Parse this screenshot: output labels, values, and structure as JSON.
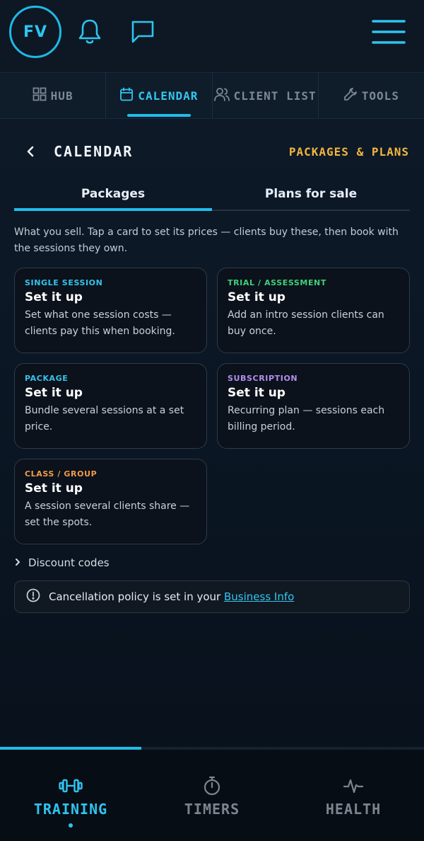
{
  "header": {
    "avatar_initials": "FV",
    "icons": [
      "bell-icon",
      "chat-icon",
      "hamburger-menu-icon"
    ]
  },
  "nav_tabs": [
    {
      "label": "HUB",
      "icon": "grid-icon",
      "active": false
    },
    {
      "label": "CALENDAR",
      "icon": "calendar-icon",
      "active": true
    },
    {
      "label": "CLIENT LIST",
      "icon": "users-icon",
      "active": false
    },
    {
      "label": "TOOLS",
      "icon": "wrench-icon",
      "active": false
    }
  ],
  "page": {
    "title": "CALENDAR",
    "section_link": "PACKAGES & PLANS"
  },
  "sub_tabs": [
    {
      "label": "Packages",
      "active": true
    },
    {
      "label": "Plans for sale",
      "active": false
    }
  ],
  "intro_text": "What you sell. Tap a card to set its prices — clients buy these, then book with the sessions they own.",
  "cards": [
    {
      "kicker": "SINGLE SESSION",
      "title": "Set it up",
      "desc": "Set what one session costs — clients pay this when booking.",
      "color": "#35c3ee"
    },
    {
      "kicker": "TRIAL / ASSESSMENT",
      "title": "Set it up",
      "desc": "Add an intro session clients can buy once.",
      "color": "#3fd07a"
    },
    {
      "kicker": "PACKAGE",
      "title": "Set it up",
      "desc": "Bundle several sessions at a set price.",
      "color": "#35c3ee"
    },
    {
      "kicker": "SUBSCRIPTION",
      "title": "Set it up",
      "desc": "Recurring plan — sessions each billing period.",
      "color": "#b58df2"
    },
    {
      "kicker": "CLASS / GROUP",
      "title": "Set it up",
      "desc": "A session several clients share — set the spots.",
      "color": "#f39a4a"
    }
  ],
  "discount_codes_label": "Discount codes",
  "notice": {
    "text": "Cancellation policy is set in your",
    "link": "Business Info"
  },
  "bottom_nav": {
    "progress_fraction": 0.333,
    "items": [
      {
        "label": "TRAINING",
        "icon": "dumbbell-icon",
        "active": true
      },
      {
        "label": "TIMERS",
        "icon": "stopwatch-icon",
        "active": false
      },
      {
        "label": "HEALTH",
        "icon": "pulse-icon",
        "active": false
      }
    ]
  },
  "colors": {
    "accent": "#1fbde9",
    "gold": "#f2b63d",
    "background": "#0c1826"
  }
}
